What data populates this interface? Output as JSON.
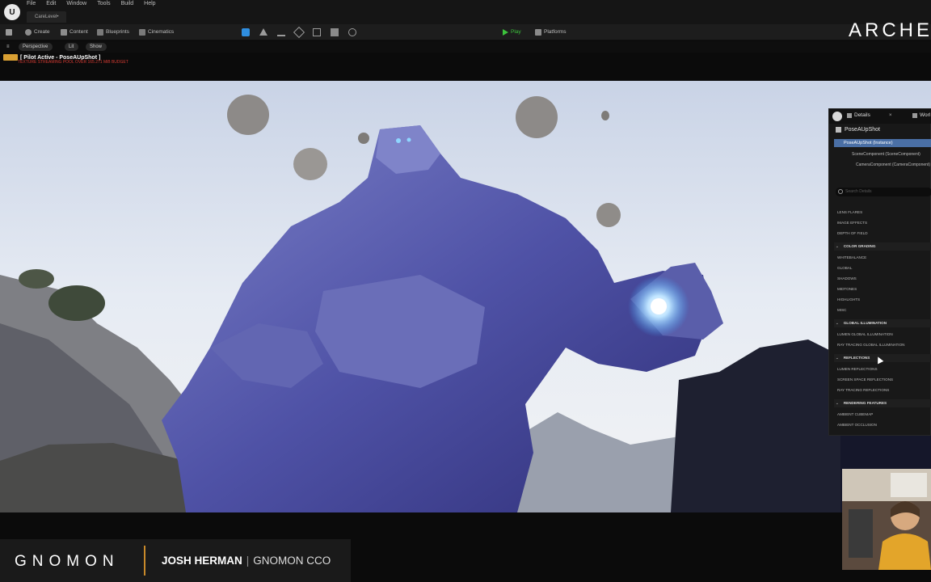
{
  "menu": {
    "items": [
      "File",
      "Edit",
      "Window",
      "Tools",
      "Build",
      "Help"
    ]
  },
  "level_tab": "CareLevel•",
  "toolbar": {
    "create": "Create",
    "content": "Content",
    "blueprints": "Blueprints",
    "cinematics": "Cinematics",
    "play": "Play",
    "platforms": "Platforms"
  },
  "overlay_logo": "ARCHE",
  "viewport": {
    "perspective": "Perspective",
    "lit": "Lit",
    "show": "Show",
    "pilot_label": "[ Pilot Active - PoseAUpShot ]",
    "warning": "TEXTURE STREAMING POOL OVER 165.271 MiB BUDGET"
  },
  "details": {
    "tab_details": "Details",
    "tab_world": "Worl",
    "actor_name": "PoseAUpShot",
    "selected_instance": "PoseAUpShot (Instance)",
    "components": [
      "SceneComponent (SceneComponent)",
      "CameraComponent (CameraComponent)"
    ],
    "search_placeholder": "Search Details",
    "rows": [
      {
        "type": "item",
        "label": "LENS FLARES"
      },
      {
        "type": "item",
        "label": "IMAGE EFFECTS"
      },
      {
        "type": "item",
        "label": "DEPTH OF FIELD"
      },
      {
        "type": "section",
        "label": "COLOR GRADING"
      },
      {
        "type": "item",
        "label": "WHITEBALANCE"
      },
      {
        "type": "item",
        "label": "GLOBAL"
      },
      {
        "type": "item",
        "label": "SHADOWS"
      },
      {
        "type": "item",
        "label": "MIDTONES"
      },
      {
        "type": "item",
        "label": "HIGHLIGHTS"
      },
      {
        "type": "item",
        "label": "MISC"
      },
      {
        "type": "section",
        "label": "GLOBAL ILLUMINATION"
      },
      {
        "type": "item",
        "label": "LUMEN GLOBAL ILLUMINATION"
      },
      {
        "type": "item",
        "label": "RAY TRACING GLOBAL ILLUMINATION"
      },
      {
        "type": "section",
        "label": "REFLECTIONS"
      },
      {
        "type": "item",
        "label": "LUMEN REFLECTIONS"
      },
      {
        "type": "item",
        "label": "SCREEN SPACE REFLECTIONS"
      },
      {
        "type": "item",
        "label": "RAY TRACING REFLECTIONS"
      },
      {
        "type": "section",
        "label": "RENDERING FEATURES"
      },
      {
        "type": "item",
        "label": "AMBIENT CUBEMAP"
      },
      {
        "type": "item",
        "label": "AMBIENT OCCLUSION"
      }
    ]
  },
  "lower_third": {
    "brand": "GNOMON",
    "name": "JOSH HERMAN",
    "separator": "|",
    "role": "GNOMON CCO",
    "accent_color": "#c98a2a"
  },
  "colors": {
    "selection": "#4a6fa5",
    "warning": "#d43b32",
    "play": "#3cc23c"
  }
}
